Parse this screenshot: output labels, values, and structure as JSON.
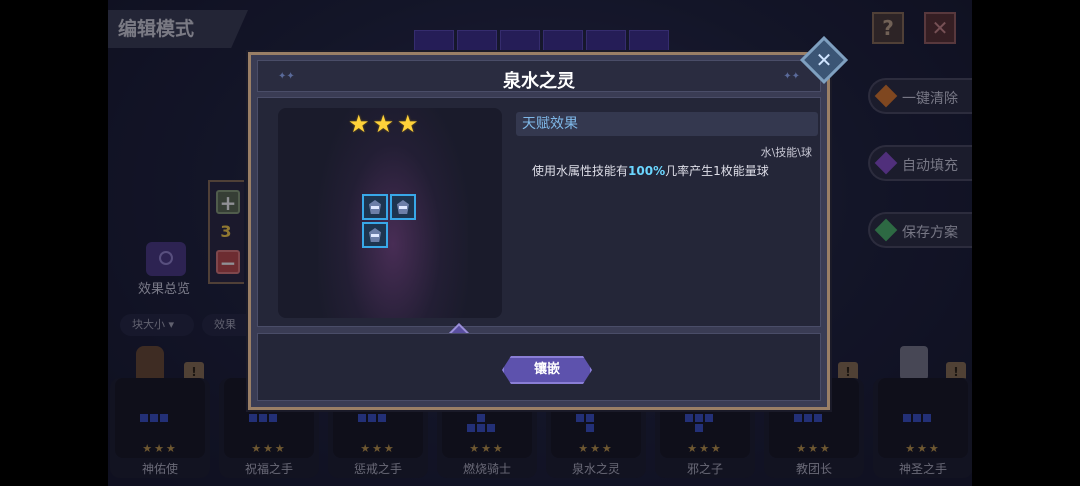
{
  "screen": {
    "title": "编辑模式",
    "help_icon": "?",
    "close_icon": "✕"
  },
  "side_buttons": [
    {
      "label": "一键清除",
      "gem_color": "#e07a2a"
    },
    {
      "label": "自动填充",
      "gem_color": "#8a4fd0"
    },
    {
      "label": "保存方案",
      "gem_color": "#4bb86a"
    }
  ],
  "stepper": {
    "plus": "+",
    "count": "3",
    "minus": "−"
  },
  "overview": {
    "label": "效果总览"
  },
  "filters": [
    {
      "label": "块大小 ▾"
    },
    {
      "label": "效果"
    }
  ],
  "lock_glyph": "!",
  "slots": [
    {
      "name": "神佑使",
      "stars": "★★★",
      "pattern": [
        1,
        1,
        1,
        0,
        0,
        0
      ]
    },
    {
      "name": "祝福之手",
      "stars": "★★★",
      "pattern": [
        1,
        1,
        1,
        0,
        0,
        0
      ]
    },
    {
      "name": "惩戒之手",
      "stars": "★★★",
      "pattern": [
        1,
        1,
        1,
        0,
        0,
        0
      ]
    },
    {
      "name": "燃烧骑士",
      "stars": "★★★",
      "pattern": [
        0,
        1,
        0,
        1,
        1,
        1
      ]
    },
    {
      "name": "泉水之灵",
      "stars": "★★★",
      "pattern": [
        1,
        1,
        0,
        0,
        1,
        0
      ]
    },
    {
      "name": "邪之子",
      "stars": "★★★",
      "pattern": [
        1,
        1,
        1,
        0,
        1,
        0
      ]
    },
    {
      "name": "教团长",
      "stars": "★★★",
      "pattern": [
        1,
        1,
        1,
        0,
        0,
        0
      ]
    },
    {
      "name": "神圣之手",
      "stars": "★★★",
      "pattern": [
        1,
        1,
        1,
        0,
        0,
        0
      ]
    }
  ],
  "dialog": {
    "title": "泉水之灵",
    "head_dots": "✦✦",
    "close": "✕",
    "stars": [
      "★",
      "★",
      "★"
    ],
    "rotate": "⟲",
    "talent": {
      "heading": "天赋效果",
      "tags": "水\\技能\\球",
      "desc_prefix": "使用水属性技能有",
      "desc_highlight": "100%",
      "desc_suffix": "几率产生1枚能量球"
    },
    "embed_button": "镶嵌"
  },
  "colors": {
    "accent_purple": "#5d52ad",
    "piece_border": "#38a8e8",
    "star_gold": "#ffd23a",
    "highlight_cyan": "#6bd6ff"
  }
}
